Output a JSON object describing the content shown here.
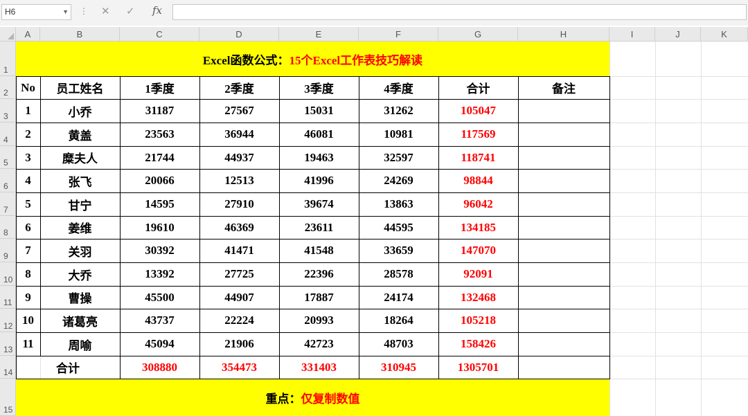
{
  "formula_bar": {
    "name_box": "H6",
    "cancel_icon": "✕",
    "enter_icon": "✓",
    "fx_label": "fx",
    "formula": ""
  },
  "columns": [
    "A",
    "B",
    "C",
    "D",
    "E",
    "F",
    "G",
    "H",
    "I",
    "J",
    "K"
  ],
  "rows": [
    "1",
    "2",
    "3",
    "4",
    "5",
    "6",
    "7",
    "8",
    "9",
    "10",
    "11",
    "12",
    "13",
    "14",
    "15"
  ],
  "title": {
    "part1": "Excel函数公式：",
    "part2": "15个Excel工作表技巧解读"
  },
  "table": {
    "headers": [
      "No",
      "员工姓名",
      "1季度",
      "2季度",
      "3季度",
      "4季度",
      "合计",
      "备注"
    ],
    "rows": [
      [
        "1",
        "小乔",
        "31187",
        "27567",
        "15031",
        "31262",
        "105047",
        ""
      ],
      [
        "2",
        "黄盖",
        "23563",
        "36944",
        "46081",
        "10981",
        "117569",
        ""
      ],
      [
        "3",
        "糜夫人",
        "21744",
        "44937",
        "19463",
        "32597",
        "118741",
        ""
      ],
      [
        "4",
        "张飞",
        "20066",
        "12513",
        "41996",
        "24269",
        "98844",
        ""
      ],
      [
        "5",
        "甘宁",
        "14595",
        "27910",
        "39674",
        "13863",
        "96042",
        ""
      ],
      [
        "6",
        "姜维",
        "19610",
        "46369",
        "23611",
        "44595",
        "134185",
        ""
      ],
      [
        "7",
        "关羽",
        "30392",
        "41471",
        "41548",
        "33659",
        "147070",
        ""
      ],
      [
        "8",
        "大乔",
        "13392",
        "27725",
        "22396",
        "28578",
        "92091",
        ""
      ],
      [
        "9",
        "曹操",
        "45500",
        "44907",
        "17887",
        "24174",
        "132468",
        ""
      ],
      [
        "10",
        "诸葛亮",
        "43737",
        "22224",
        "20993",
        "18264",
        "105218",
        ""
      ],
      [
        "11",
        "周喻",
        "45094",
        "21906",
        "42723",
        "48703",
        "158426",
        ""
      ]
    ],
    "total": {
      "label": "合计",
      "values": [
        "308880",
        "354473",
        "331403",
        "310945",
        "1305701"
      ]
    }
  },
  "footer": {
    "part1": "重点：",
    "part2": "仅复制数值"
  },
  "colors": {
    "highlight": "#ffff00",
    "accent_text": "#ff0000"
  }
}
